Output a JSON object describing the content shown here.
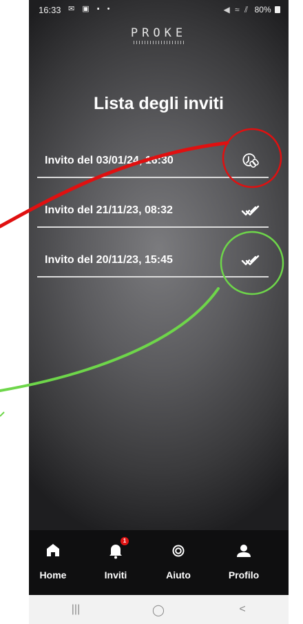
{
  "status_bar": {
    "time": "16:33",
    "left_icons": "✉ ▣ ▪ •",
    "signal": "◀ ≈ ⫽",
    "battery": "80%"
  },
  "app": {
    "logo": "PROKE",
    "title": "Lista degli inviti"
  },
  "invites": [
    {
      "label": "Invito del 03/01/24, 16:30",
      "status_icon": "pending-clock-icon"
    },
    {
      "label": "Invito del 21/11/23, 08:32",
      "status_icon": "double-check-icon"
    },
    {
      "label": "Invito del 20/11/23, 15:45",
      "status_icon": "double-check-icon"
    }
  ],
  "annotations": {
    "pending_circle_color": "#e01010",
    "done_circle_color": "#6ed64a"
  },
  "nav": {
    "items": [
      {
        "label": "Home",
        "icon": "home-icon"
      },
      {
        "label": "Inviti",
        "icon": "bell-icon",
        "badge": "1"
      },
      {
        "label": "Aiuto",
        "icon": "lifebuoy-icon"
      },
      {
        "label": "Profilo",
        "icon": "profile-icon"
      }
    ]
  },
  "system_nav": {
    "recents": "|||",
    "home": "◯",
    "back": "<"
  }
}
